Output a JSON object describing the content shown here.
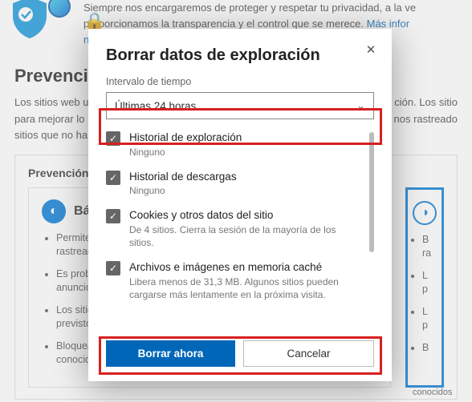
{
  "bg": {
    "intro1": "Siempre nos encargaremos de proteger y respetar tu privacidad, a la ve",
    "intro2": "proporcionamos la transparencia y el control que se merece. ",
    "link": "Más infor",
    "link2_truncated": "nuestros esfuerzos de privacidad",
    "heading": "Prevención",
    "para1a": "Los sitios web u",
    "para1b": "ción. Los sitio",
    "para2a": "para mejorar lo",
    "para2b": "nos rastreado",
    "para3": "sitios que no ha",
    "panel_title": "Prevención d",
    "card1": {
      "title": "Bá",
      "li1": "Permite l",
      "li1b": "rastreado",
      "li2": "Es proba",
      "li2b": "anuncios",
      "li3": "Los sitios",
      "li3b": "previsto",
      "li4": "Bloquea",
      "li4b": "conocido"
    },
    "card2": {
      "li1": "B",
      "li1b": "ra",
      "li2": "L",
      "li2b": "p",
      "li3": "L",
      "li3b": "p",
      "li4": "B",
      "li4b": "conocidos"
    }
  },
  "modal": {
    "title": "Borrar datos de exploración",
    "label": "Intervalo de tiempo",
    "select_value": "Últimas 24 horas",
    "items": [
      {
        "title": "Historial de exploración",
        "sub": "Ninguno",
        "checked": true
      },
      {
        "title": "Historial de descargas",
        "sub": "Ninguno",
        "checked": true
      },
      {
        "title": "Cookies y otros datos del sitio",
        "sub": "De 4 sitios. Cierra la sesión de la mayoría de los sitios.",
        "checked": true
      },
      {
        "title": "Archivos e imágenes en memoria caché",
        "sub": "Libera menos de 31,3 MB. Algunos sitios pueden cargarse más lentamente en la próxima visita.",
        "checked": true
      }
    ],
    "primary": "Borrar ahora",
    "secondary": "Cancelar"
  }
}
